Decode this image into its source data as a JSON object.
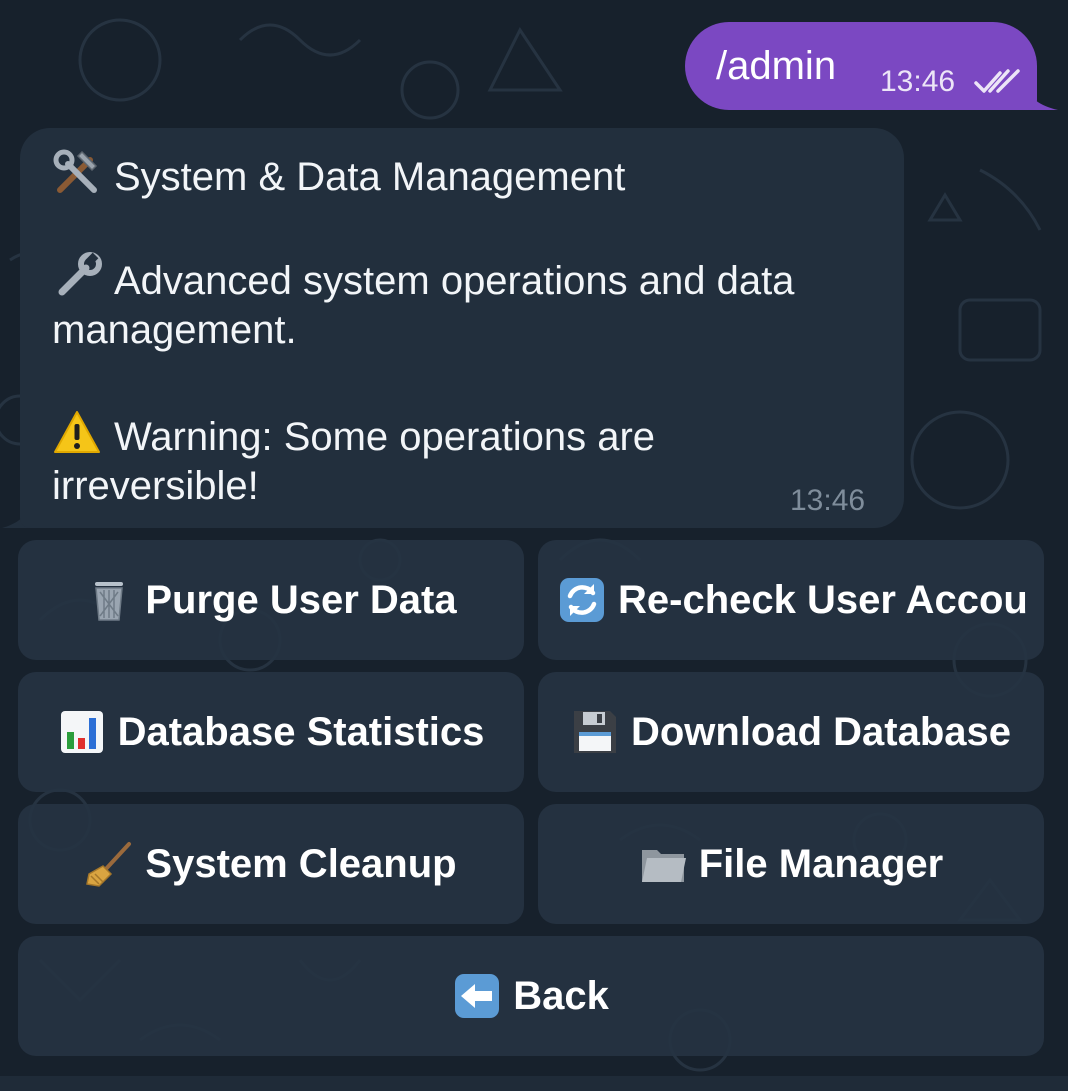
{
  "outgoing": {
    "text": "/admin",
    "time": "13:46",
    "status_icon": "double-check-icon"
  },
  "incoming": {
    "title_icon": "hammer-and-wrench-icon",
    "title": "System & Data Management",
    "desc_icon": "wrench-icon",
    "desc_line1": "Advanced system operations and data",
    "desc_line2": "management.",
    "warning_icon": "warning-icon",
    "warning_line1": "Warning: Some operations are",
    "warning_line2": "irreversible!",
    "time": "13:46"
  },
  "keyboard": {
    "purge": {
      "label": "Purge User Data",
      "icon": "wastebasket-icon"
    },
    "recheck": {
      "label": "Re-check User Accou",
      "icon": "refresh-icon"
    },
    "stats": {
      "label": "Database Statistics",
      "icon": "bar-chart-icon"
    },
    "download": {
      "label": "Download Database",
      "icon": "floppy-disk-icon"
    },
    "cleanup": {
      "label": "System Cleanup",
      "icon": "broom-icon"
    },
    "files": {
      "label": "File Manager",
      "icon": "folder-icon"
    },
    "back": {
      "label": "Back",
      "icon": "left-arrow-icon"
    }
  },
  "colors": {
    "background": "#17212c",
    "outgoing_bubble": "#7b48c2",
    "incoming_bubble": "#222f3d",
    "button": "#263342",
    "muted_text": "#7f8d9b"
  }
}
